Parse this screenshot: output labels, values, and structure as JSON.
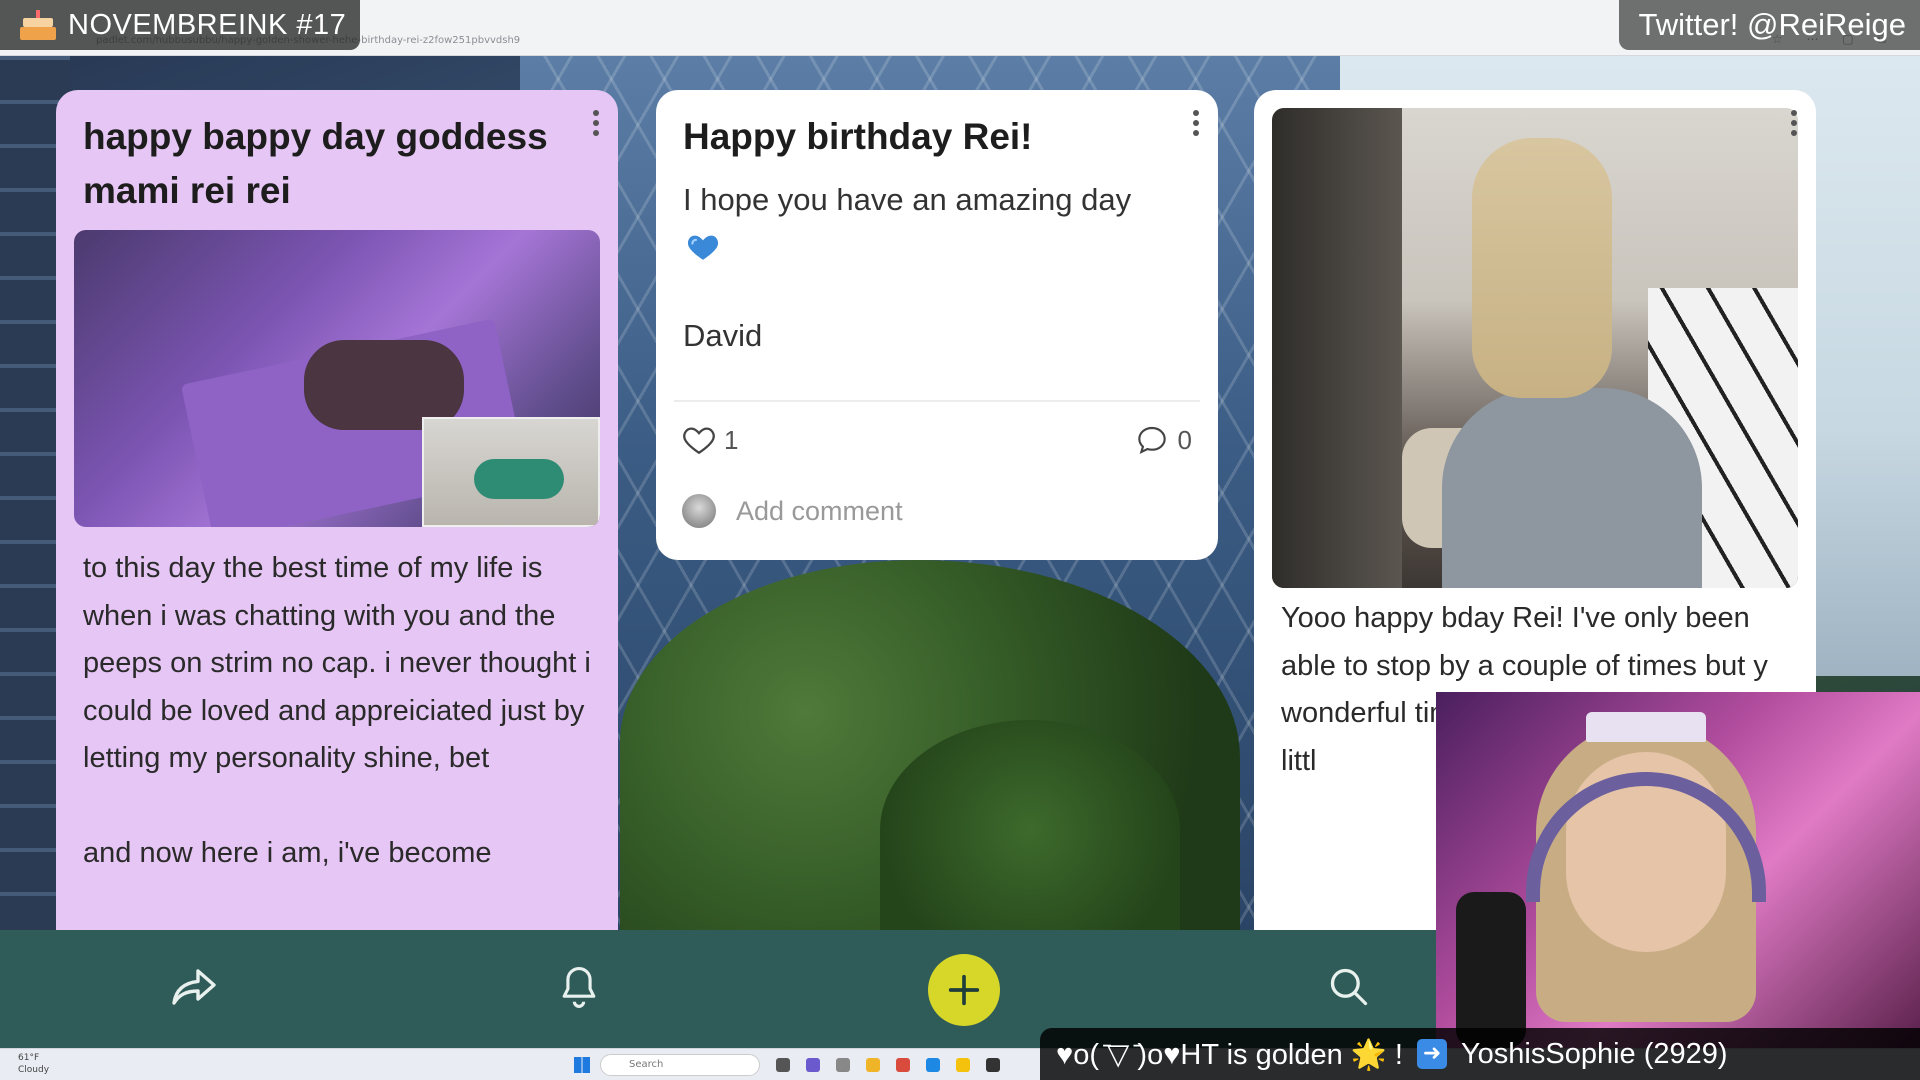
{
  "overlay": {
    "title": "NOVEMBREINK #17",
    "twitter": "Twitter! @ReiReige"
  },
  "browser": {
    "url": "padlet.com/hubbusubbu/happy-golden-shower-hehe-birthday-rei-z2fow251pbvvdsh9"
  },
  "cards": [
    {
      "title": "happy bappy day goddess mami rei rei",
      "image": "yoga-stream-screenshot",
      "body": "to this day the best time of my life is when i was chatting with you and the peeps on strim no cap. i never thought i could be loved and appreiciated just by letting my personality shine, bet\n\nand now here i am, i've become"
    },
    {
      "title": "Happy birthday Rei!",
      "body": "I hope you have an amazing day",
      "emoji": "blue-heart",
      "signature": "David",
      "likes": "1",
      "comments": "0",
      "add_comment_placeholder": "Add comment"
    },
    {
      "image": "hand-mask-photo",
      "body": "Yooo happy bday Rei! I've only been able to stop by a couple of times but y wonderful time with & hopes fo year! ~ littl"
    }
  ],
  "toolbar": {
    "icons": [
      "share-icon",
      "bell-icon",
      "add-icon",
      "search-icon"
    ],
    "accent": "#d7d72a",
    "background": "#2f5c58"
  },
  "taskbar": {
    "weather_temp": "61°F",
    "weather_text": "Cloudy",
    "search_placeholder": "Search"
  },
  "ticker": {
    "message": "♥o( ̄▽ ̄)o♥HT is golden 🌟 !",
    "user": "YoshisSophie (2929)"
  }
}
